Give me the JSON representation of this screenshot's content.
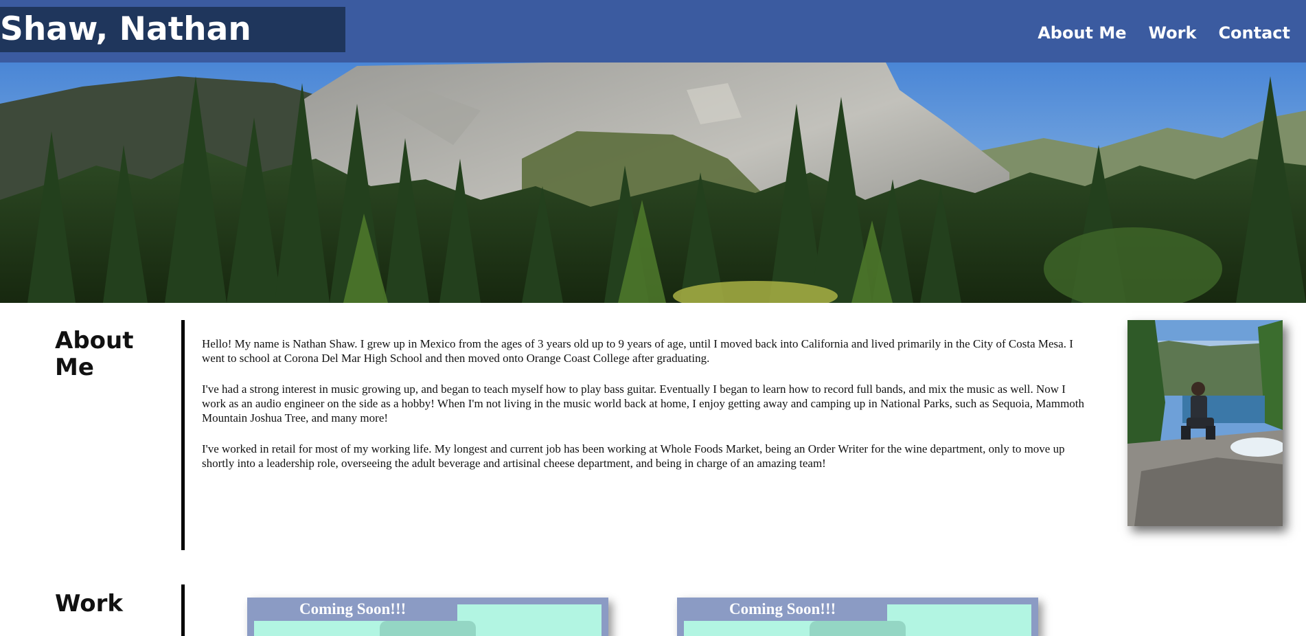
{
  "header": {
    "name": "Shaw, Nathan",
    "nav": [
      {
        "label": "About Me"
      },
      {
        "label": "Work"
      },
      {
        "label": "Contact"
      }
    ],
    "colors": {
      "bar": "#3b5ba0",
      "name_block": "#1f365c"
    }
  },
  "about": {
    "title": "About Me",
    "paragraphs": [
      "Hello! My name is Nathan Shaw. I grew up in Mexico from the ages of 3 years old up to 9 years of age, until I moved back into California and lived primarily in the City of Costa Mesa. I went to school at Corona Del Mar High School and then moved onto Orange Coast College after graduating.",
      "I've had a strong interest in music growing up, and began to teach myself how to play bass guitar. Eventually I began to learn how to record full bands, and mix the music as well. Now I work as an audio engineer on the side as a hobby! When I'm not living in the music world back at home, I enjoy getting away and camping up in National Parks, such as Sequoia, Mammoth Mountain Joshua Tree, and many more!",
      "I've worked in retail for most of my working life. My longest and current job has been working at Whole Foods Market, being an Order Writer for the wine department, only to move up shortly into a leadership role, overseeing the adult beverage and artisinal cheese department, and being in charge of an amazing team!"
    ]
  },
  "work": {
    "title": "Work",
    "cards": [
      {
        "label": "Coming Soon!!!"
      },
      {
        "label": "Coming Soon!!!"
      }
    ]
  }
}
